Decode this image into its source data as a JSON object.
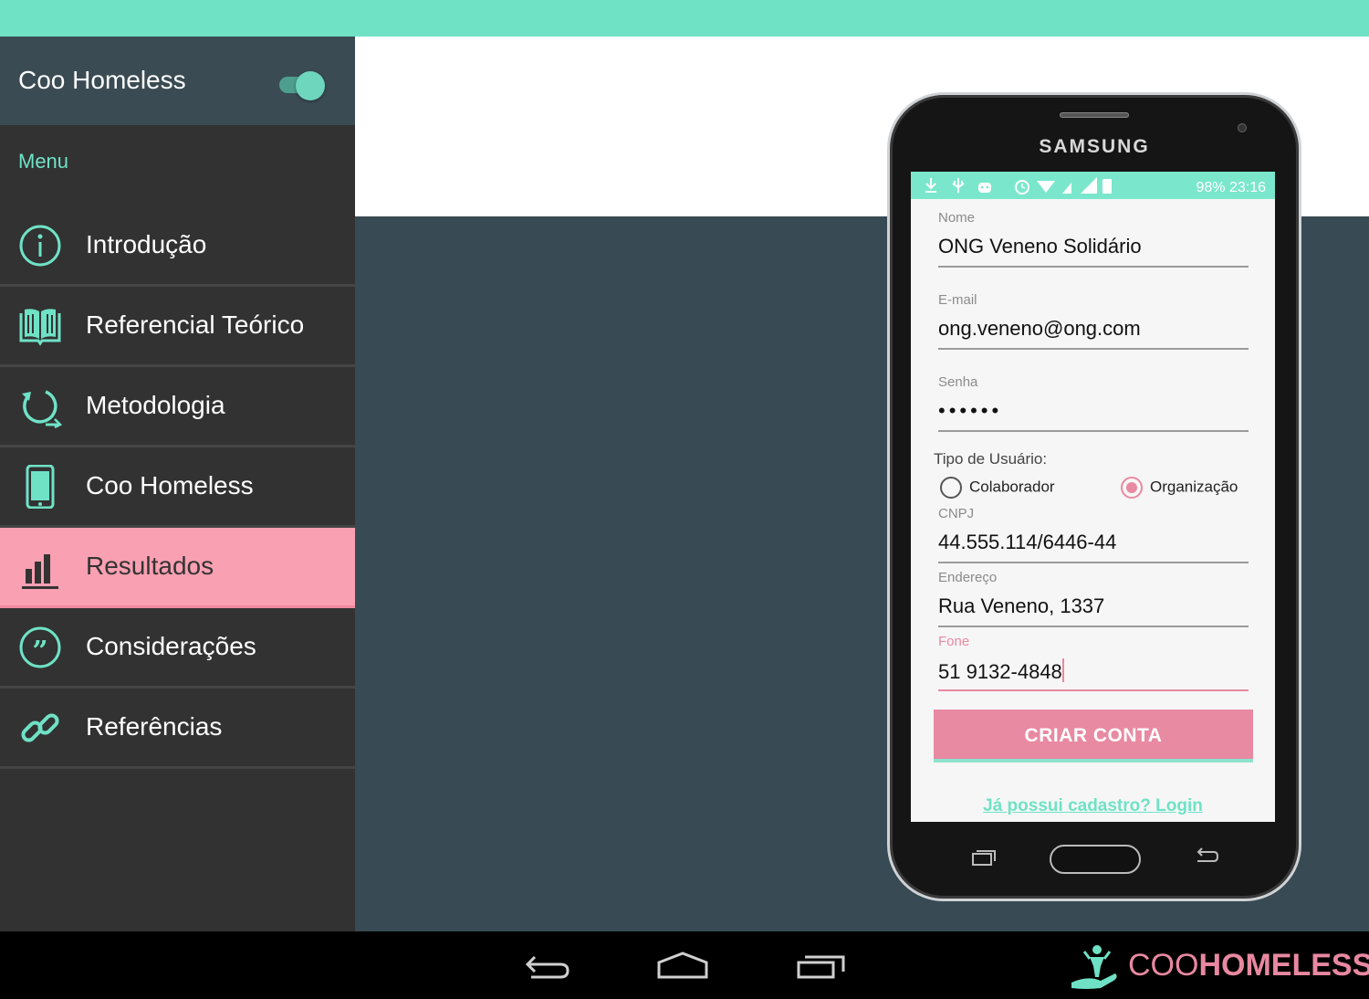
{
  "app": {
    "title": "Coo Homeless"
  },
  "sidebar": {
    "menu_label": "Menu",
    "items": [
      {
        "label": "Introdução",
        "icon": "info-icon",
        "active": false
      },
      {
        "label": "Referencial Teórico",
        "icon": "book-icon",
        "active": false
      },
      {
        "label": "Metodologia",
        "icon": "cycle-icon",
        "active": false
      },
      {
        "label": "Coo Homeless",
        "icon": "phone-icon",
        "active": false
      },
      {
        "label": "Resultados",
        "icon": "bar-chart-icon",
        "active": true
      },
      {
        "label": "Considerações",
        "icon": "quote-icon",
        "active": false
      },
      {
        "label": "Referências",
        "icon": "link-icon",
        "active": false
      }
    ]
  },
  "phone": {
    "brand": "SAMSUNG",
    "status": {
      "right_text": "98% 23:16"
    },
    "form": {
      "nome_label": "Nome",
      "nome_value": "ONG Veneno Solidário",
      "email_label": "E-mail",
      "email_value": "ong.veneno@ong.com",
      "senha_label": "Senha",
      "senha_value": "••••••",
      "tipo_label": "Tipo de Usuário:",
      "radio_colaborador": "Colaborador",
      "radio_organizacao": "Organização",
      "selected": "Organização",
      "cnpj_label": "CNPJ",
      "cnpj_value": "44.555.114/6446-44",
      "endereco_label": "Endereço",
      "endereco_value": "Rua Veneno, 1337",
      "fone_label": "Fone",
      "fone_value": "51 9132-4848",
      "submit_label": "CRIAR CONTA",
      "login_link": "Já possui cadastro? Login"
    }
  },
  "brand": {
    "prefix": "COO",
    "suffix": "HOMELESS"
  },
  "colors": {
    "accent": "#6fe2c6",
    "pink": "#f9a0b2",
    "pink_dark": "#e88aa2",
    "sidebar_bg": "#323232",
    "main_bg": "#384a53"
  }
}
